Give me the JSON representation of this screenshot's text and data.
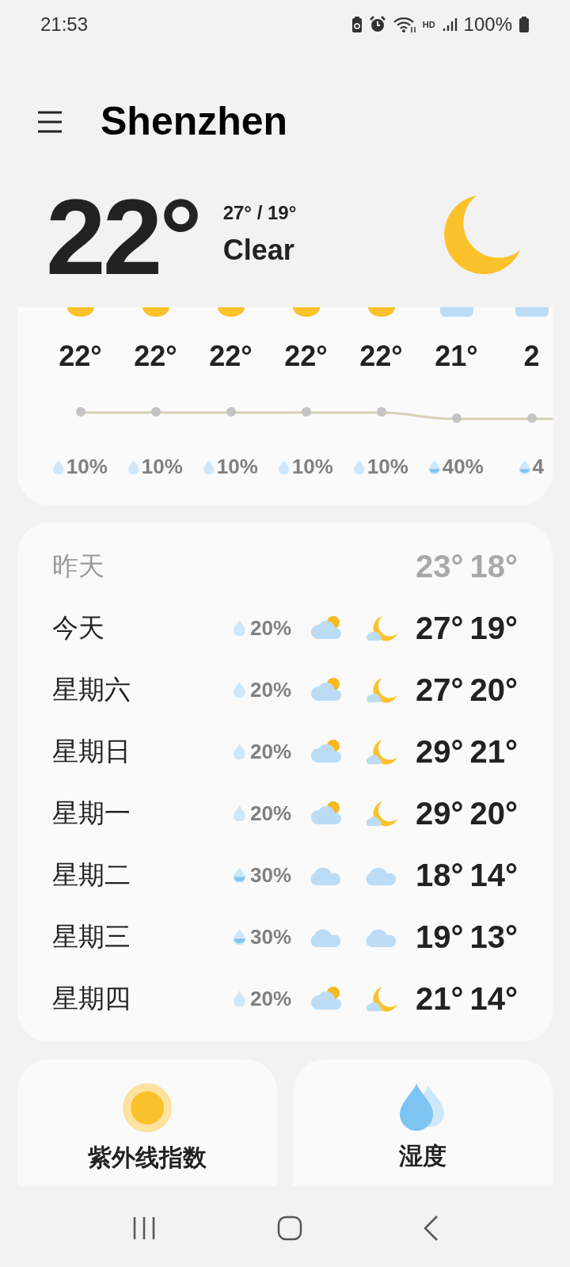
{
  "status_bar": {
    "time": "21:53",
    "network_label": "HD",
    "battery": "100%"
  },
  "header": {
    "city": "Shenzhen"
  },
  "current": {
    "temperature": "22°",
    "high_low": "27° / 19°",
    "condition": "Clear"
  },
  "hourly": [
    {
      "kind": "sun",
      "temperature": "22°",
      "precipitation": {
        "kind": "light",
        "text": "10%"
      }
    },
    {
      "kind": "sun",
      "temperature": "22°",
      "precipitation": {
        "kind": "light",
        "text": "10%"
      }
    },
    {
      "kind": "sun",
      "temperature": "22°",
      "precipitation": {
        "kind": "light",
        "text": "10%"
      }
    },
    {
      "kind": "sun",
      "temperature": "22°",
      "precipitation": {
        "kind": "light",
        "text": "10%"
      }
    },
    {
      "kind": "sun",
      "temperature": "22°",
      "precipitation": {
        "kind": "light",
        "text": "10%"
      }
    },
    {
      "kind": "cloud",
      "temperature": "21°",
      "precipitation": {
        "kind": "half",
        "text": "40%"
      }
    },
    {
      "kind": "cloud",
      "temperature": "2",
      "precipitation": {
        "kind": "half",
        "text": "4"
      }
    }
  ],
  "daily": [
    {
      "kind": "past",
      "day": "昨天",
      "high": "23°",
      "low": "18°"
    },
    {
      "kind": "forecast",
      "day": "今天",
      "precipitation": {
        "kind": "light",
        "text": "20%"
      },
      "icons": [
        {
          "kind": "partly-cloudy"
        },
        {
          "kind": "moon-cloud"
        }
      ],
      "high": "27°",
      "low": "19°"
    },
    {
      "kind": "forecast",
      "day": "星期六",
      "precipitation": {
        "kind": "light",
        "text": "20%"
      },
      "icons": [
        {
          "kind": "partly-cloudy"
        },
        {
          "kind": "moon-cloud"
        }
      ],
      "high": "27°",
      "low": "20°"
    },
    {
      "kind": "forecast",
      "day": "星期日",
      "precipitation": {
        "kind": "light",
        "text": "20%"
      },
      "icons": [
        {
          "kind": "partly-cloudy"
        },
        {
          "kind": "moon-cloud"
        }
      ],
      "high": "29°",
      "low": "21°"
    },
    {
      "kind": "forecast",
      "day": "星期一",
      "precipitation": {
        "kind": "light",
        "text": "20%"
      },
      "icons": [
        {
          "kind": "partly-cloudy"
        },
        {
          "kind": "moon-cloud"
        }
      ],
      "high": "29°",
      "low": "20°"
    },
    {
      "kind": "forecast",
      "day": "星期二",
      "precipitation": {
        "kind": "half",
        "text": "30%"
      },
      "icons": [
        {
          "kind": "cloud"
        },
        {
          "kind": "cloud"
        }
      ],
      "high": "18°",
      "low": "14°"
    },
    {
      "kind": "forecast",
      "day": "星期三",
      "precipitation": {
        "kind": "half",
        "text": "30%"
      },
      "icons": [
        {
          "kind": "cloud"
        },
        {
          "kind": "cloud"
        }
      ],
      "high": "19°",
      "low": "13°"
    },
    {
      "kind": "forecast",
      "day": "星期四",
      "precipitation": {
        "kind": "light",
        "text": "20%"
      },
      "icons": [
        {
          "kind": "partly-cloudy"
        },
        {
          "kind": "moon-cloud"
        }
      ],
      "high": "21°",
      "low": "14°"
    }
  ],
  "details": [
    {
      "label": "紫外线指数"
    },
    {
      "label": "湿度"
    }
  ]
}
